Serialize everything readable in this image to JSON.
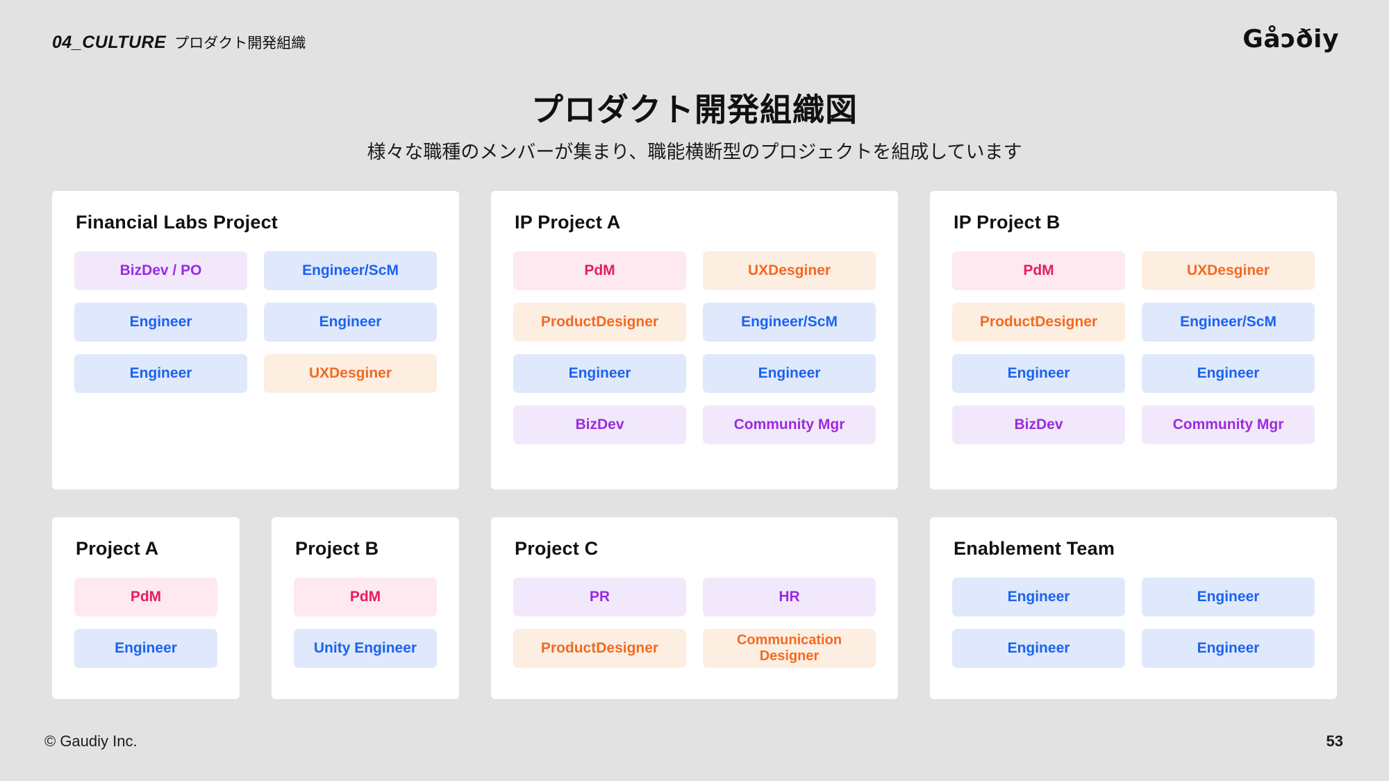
{
  "header": {
    "eyebrow": "04_CULTURE",
    "section": "プロダクト開発組織",
    "brand": "Gåɔðiy"
  },
  "title": "プロダクト開発組織図",
  "subtitle": "様々な職種のメンバーが集まり、職能横断型のプロジェクトを組成しています",
  "footer": {
    "copyright": "© Gaudiy Inc.",
    "page_number": "53"
  },
  "role_colors": {
    "pdm_bg": "#fde9ef",
    "pdm_fg": "#e21f5e",
    "engineer_bg": "#e0e8fc",
    "engineer_fg": "#1a63ef",
    "bizdev_bg": "#f1e9fb",
    "bizdev_fg": "#9c2ae0",
    "designer_bg": "#fdeee2",
    "designer_fg": "#f26a22"
  },
  "cards": {
    "financial_labs": {
      "title": "Financial Labs Project",
      "roles": [
        "BizDev / PO",
        "Engineer/ScM",
        "Engineer",
        "Engineer",
        "Engineer",
        "UXDesginer"
      ]
    },
    "ip_project_a": {
      "title": "IP Project A",
      "roles": [
        "PdM",
        "UXDesginer",
        "ProductDesigner",
        "Engineer/ScM",
        "Engineer",
        "Engineer",
        "BizDev",
        "Community Mgr"
      ]
    },
    "ip_project_b": {
      "title": "IP Project B",
      "roles": [
        "PdM",
        "UXDesginer",
        "ProductDesigner",
        "Engineer/ScM",
        "Engineer",
        "Engineer",
        "BizDev",
        "Community Mgr"
      ]
    },
    "project_a": {
      "title": "Project A",
      "roles": [
        "PdM",
        "Engineer"
      ]
    },
    "project_b": {
      "title": "Project B",
      "roles": [
        "PdM",
        "Unity Engineer"
      ]
    },
    "project_c": {
      "title": "Project C",
      "roles": [
        "PR",
        "HR",
        "ProductDesigner",
        "Communication Designer"
      ]
    },
    "enablement_team": {
      "title": "Enablement Team",
      "roles": [
        "Engineer",
        "Engineer",
        "Engineer",
        "Engineer"
      ]
    }
  }
}
